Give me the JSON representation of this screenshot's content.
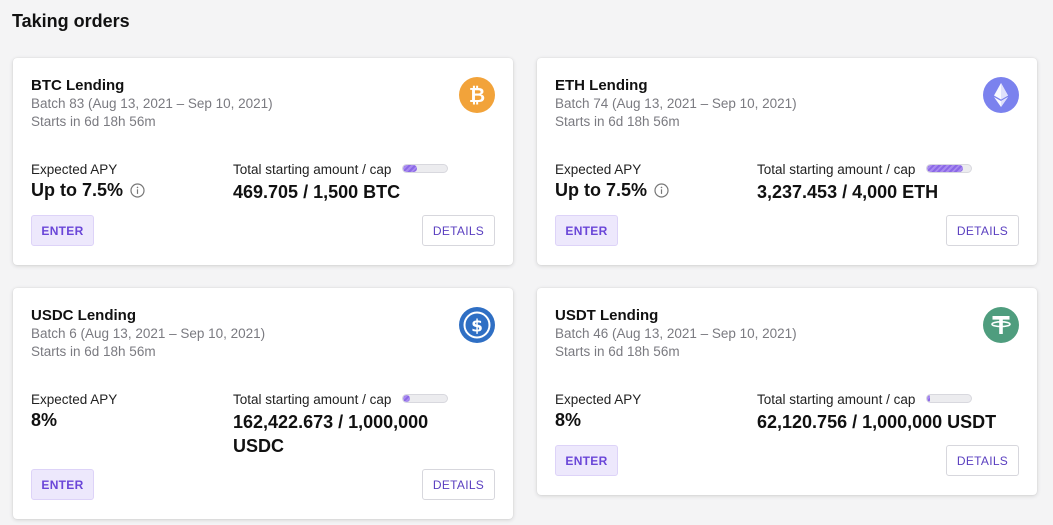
{
  "section": {
    "title": "Taking orders"
  },
  "labels": {
    "expected_apy": "Expected APY",
    "total_cap": "Total starting amount / cap",
    "enter": "ENTER",
    "details": "DETAILS"
  },
  "cards": [
    {
      "title": "BTC Lending",
      "batch": "Batch 83 (Aug 13, 2021 – Sep 10, 2021)",
      "starts": "Starts in 6d 18h 56m",
      "apy": "Up to 7.5%",
      "amount": "469.705 / 1,500 BTC",
      "progress": 0.31,
      "icon": "bitcoin-icon",
      "color": "#f2a33a"
    },
    {
      "title": "ETH Lending",
      "batch": "Batch 74 (Aug 13, 2021 – Sep 10, 2021)",
      "starts": "Starts in 6d 18h 56m",
      "apy": "Up to 7.5%",
      "amount": "3,237.453 / 4,000 ETH",
      "progress": 0.81,
      "icon": "ethereum-icon",
      "color": "#7b82ee"
    },
    {
      "title": "USDC Lending",
      "batch": "Batch 6 (Aug 13, 2021 – Sep 10, 2021)",
      "starts": "Starts in 6d 18h 56m",
      "apy": "8%",
      "amount": "162,422.673 / 1,000,000 USDC",
      "progress": 0.16,
      "icon": "usdc-icon",
      "color": "#2f6fc4"
    },
    {
      "title": "USDT Lending",
      "batch": "Batch 46 (Aug 13, 2021 – Sep 10, 2021)",
      "starts": "Starts in 6d 18h 56m",
      "apy": "8%",
      "amount": "62,120.756 / 1,000,000 USDT",
      "progress": 0.06,
      "icon": "tether-icon",
      "color": "#4f9d7e"
    }
  ]
}
